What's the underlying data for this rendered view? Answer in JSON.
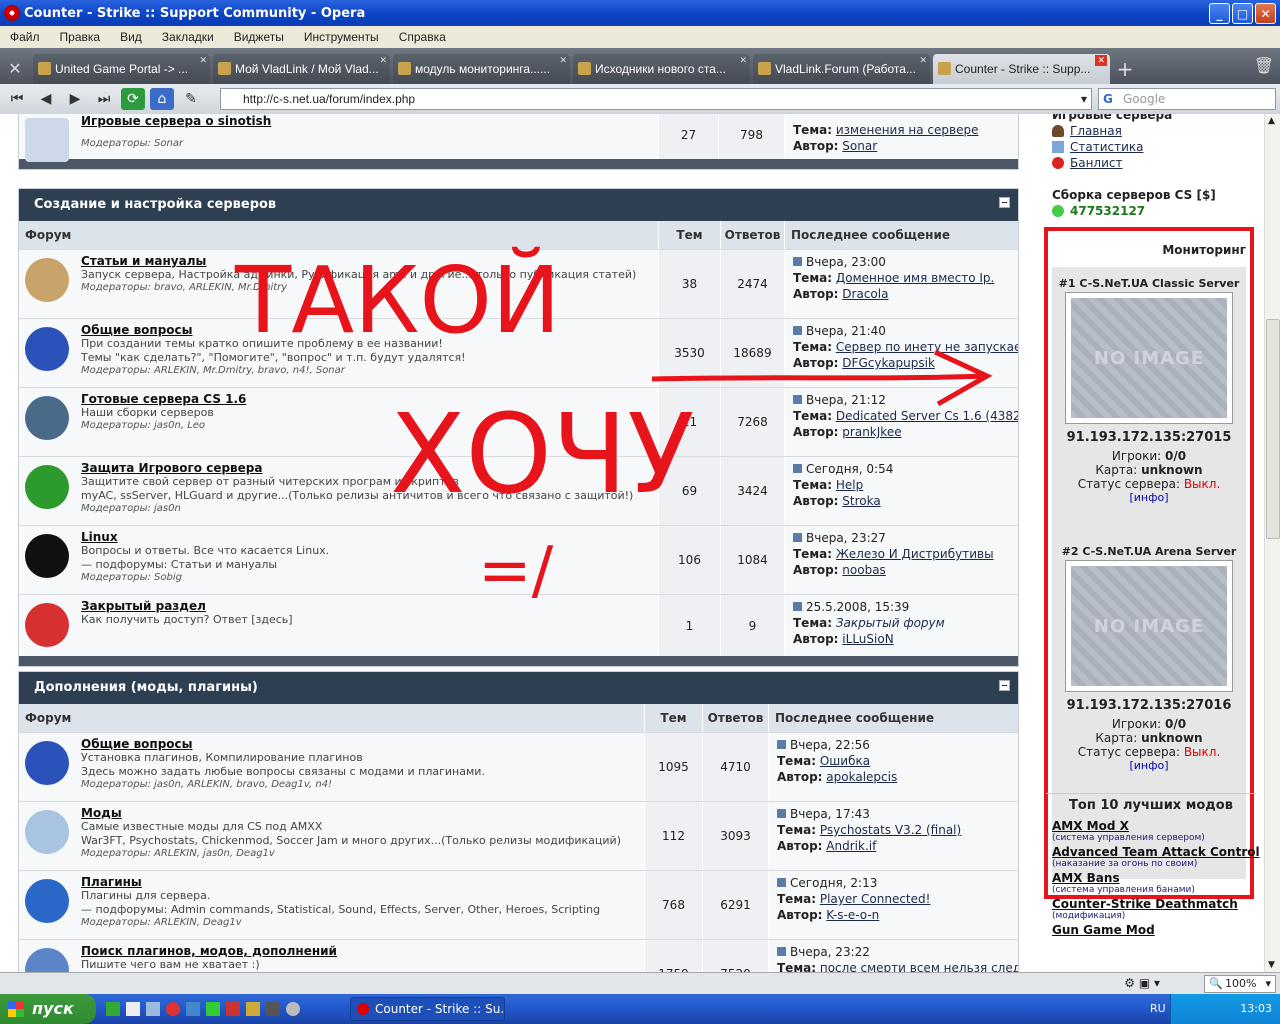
{
  "window": {
    "title": "Counter - Strike :: Support Community - Opera"
  },
  "menu": [
    "Файл",
    "Правка",
    "Вид",
    "Закладки",
    "Виджеты",
    "Инструменты",
    "Справка"
  ],
  "tabs": [
    "United Game Portal -> ...",
    "Мой VladLink / Мой Vlad...",
    "модуль мониторинга......",
    "Исходники нового ста...",
    "VladLink.Forum (Работа...",
    "Counter - Strike :: Supp..."
  ],
  "address": {
    "url": "http://c-s.net.ua/forum/index.php",
    "search_placeholder": "Google"
  },
  "top_partial": {
    "name": "Игровые сервера о sinotish",
    "mods": "Модераторы: Sonar",
    "topics": "27",
    "replies": "798",
    "last_topic": "изменения на сервере",
    "last_author": "Sonar"
  },
  "cat1": {
    "title": "Создание и настройка серверов",
    "cols": {
      "forum": "Форум",
      "topics": "Тем",
      "replies": "Ответов",
      "last": "Последнее сообщение"
    },
    "rows": [
      {
        "name": "Статьи и мануалы",
        "desc": "Запуск сервера, Настройка админки, Русификация amx и другие...(только публикация статей)",
        "mods": "Модераторы: bravo, ARLEKIN, Mr.Dmitry",
        "topics": "38",
        "replies": "2474",
        "date": "Вчера, 23:00",
        "topic": "Доменное имя вместо Ip.",
        "author": "Dracola"
      },
      {
        "name": "Общие вопросы",
        "desc": "При создании темы кратко опишите проблему в ее названии!",
        "desc2": "Темы \"как сделать?\", \"Помогите\", \"вопрос\" и т.п. будут удалятся!",
        "mods": "Модераторы: ARLEKIN, Mr.Dmitry, bravo, n4!, Sonar",
        "topics": "3530",
        "replies": "18689",
        "date": "Вчера, 21:40",
        "topic": "Сервер по инету не запускается",
        "author": "DFGcykapupsik"
      },
      {
        "name": "Готовые сервера CS 1.6",
        "desc": "Наши сборки серверов",
        "mods": "Модераторы: jas0n, Leo",
        "topics": "11",
        "replies": "7268",
        "date": "Вчера, 21:12",
        "topic": "Dedicated Server Cs 1.6 (4382)...",
        "author": "prankJkee"
      },
      {
        "name": "Защита Игрового сервера",
        "desc": "Защитите свой сервер от разный читерских програм и скриптов",
        "desc2": "myAC, ssServer, HLGuard и другие...(Только релизы античитов и всего что связано с защитой!)",
        "mods": "Модераторы: jas0n",
        "topics": "69",
        "replies": "3424",
        "date": "Сегодня, 0:54",
        "topic": "Help",
        "author": "Stroka"
      },
      {
        "name": "Linux",
        "desc": "Вопросы и ответы. Все что касается Linux.",
        "desc2": "— подфорумы: Статьи и мануалы",
        "mods": "Модераторы: Sobig",
        "topics": "106",
        "replies": "1084",
        "date": "Вчера, 23:27",
        "topic": "Железо И Дистрибутивы",
        "author": "noobas"
      },
      {
        "name": "Закрытый раздел",
        "desc": "Как получить доступ? Ответ [здесь]",
        "mods": "",
        "topics": "1",
        "replies": "9",
        "date": "25.5.2008, 15:39",
        "topic": "Закрытый форум",
        "author": "iLLuSioN"
      }
    ]
  },
  "cat2": {
    "title": "Дополнения (моды, плагины)",
    "rows": [
      {
        "name": "Общие вопросы",
        "desc": "Установка плагинов, Компилирование плагинов",
        "desc2": "Здесь можно задать любые вопросы связаны с модами и плагинами.",
        "mods": "Модераторы: jas0n, ARLEKIN, bravo, Deag1v, n4!",
        "topics": "1095",
        "replies": "4710",
        "date": "Вчера, 22:56",
        "topic": "Ошибка",
        "author": "apokalepcis"
      },
      {
        "name": "Моды",
        "desc": "Самые известные моды для CS под AMXX",
        "desc2": "War3FT, Psychostats, Chickenmod, Soccer Jam и много других...(Только релизы модификаций)",
        "mods": "Модераторы: ARLEKIN, jas0n, Deag1v",
        "topics": "112",
        "replies": "3093",
        "date": "Вчера, 17:43",
        "topic": "Psychostats V3.2 (final)",
        "author": "Andrik.if"
      },
      {
        "name": "Плагины",
        "desc": "Плагины для сервера.",
        "desc2": "— подфорумы: Admin commands, Statistical, Sound, Effects, Server, Other, Heroes, Scripting",
        "mods": "Модераторы: ARLEKIN, Deag1v",
        "topics": "768",
        "replies": "6291",
        "date": "Сегодня, 2:13",
        "topic": "Player Connected!",
        "author": "K-s-e-o-n"
      },
      {
        "name": "Поиск плагинов, модов, дополнений",
        "desc": "Пишите чего вам не хватает :)",
        "mods": "",
        "topics": "1759",
        "replies": "7520",
        "date": "Вчера, 23:22",
        "topic": "после смерти всем нельзя следи...",
        "author": ""
      }
    ]
  },
  "labels": {
    "topic": "Тема:",
    "author": "Автор:"
  },
  "sidebar": {
    "partial_header": "Игровые сервера",
    "links": [
      "Главная",
      "Статистика",
      "Банлист"
    ],
    "build_title": "Сборка серверов CS [$]",
    "icq": "477532127",
    "monitoring_title": "Мониторинг",
    "servers": [
      {
        "name": "#1 C-S.NeT.UA Classic Server",
        "noimg": "NO IMAGE",
        "ip": "91.193.172.135:27015",
        "players_label": "Игроки:",
        "players": "0/0",
        "map_label": "Карта:",
        "map": "unknown",
        "status_label": "Статус сервера:",
        "status": "Выкл.",
        "info": "[инфо]"
      },
      {
        "name": "#2 C-S.NeT.UA Arena Server",
        "noimg": "NO IMAGE",
        "ip": "91.193.172.135:27016",
        "players_label": "Игроки:",
        "players": "0/0",
        "map_label": "Карта:",
        "map": "unknown",
        "status_label": "Статус сервера:",
        "status": "Выкл.",
        "info": "[инфо]"
      }
    ],
    "top10_title": "Топ 10 лучших модов",
    "mods": [
      {
        "name": "AMX Mod X",
        "desc": "(система управления сервером)"
      },
      {
        "name": "Advanced Team Attack Control",
        "desc": "(наказание за огонь по своим)"
      },
      {
        "name": "AMX Bans",
        "desc": "(система управления банами)"
      },
      {
        "name": "Counter-Strike Deathmatch",
        "desc": "(модификация)"
      },
      {
        "name": "Gun Game Mod",
        "desc": ""
      }
    ]
  },
  "annotation": {
    "word1": "ТАКОЙ",
    "word2": "ХОЧУ",
    "word3": "=/",
    "color": "#e8141c"
  },
  "statusbar": {
    "zoom": "100%"
  },
  "taskbar": {
    "start": "пуск",
    "task": "Counter - Strike :: Su...",
    "lang": "RU",
    "time": "13:03"
  }
}
